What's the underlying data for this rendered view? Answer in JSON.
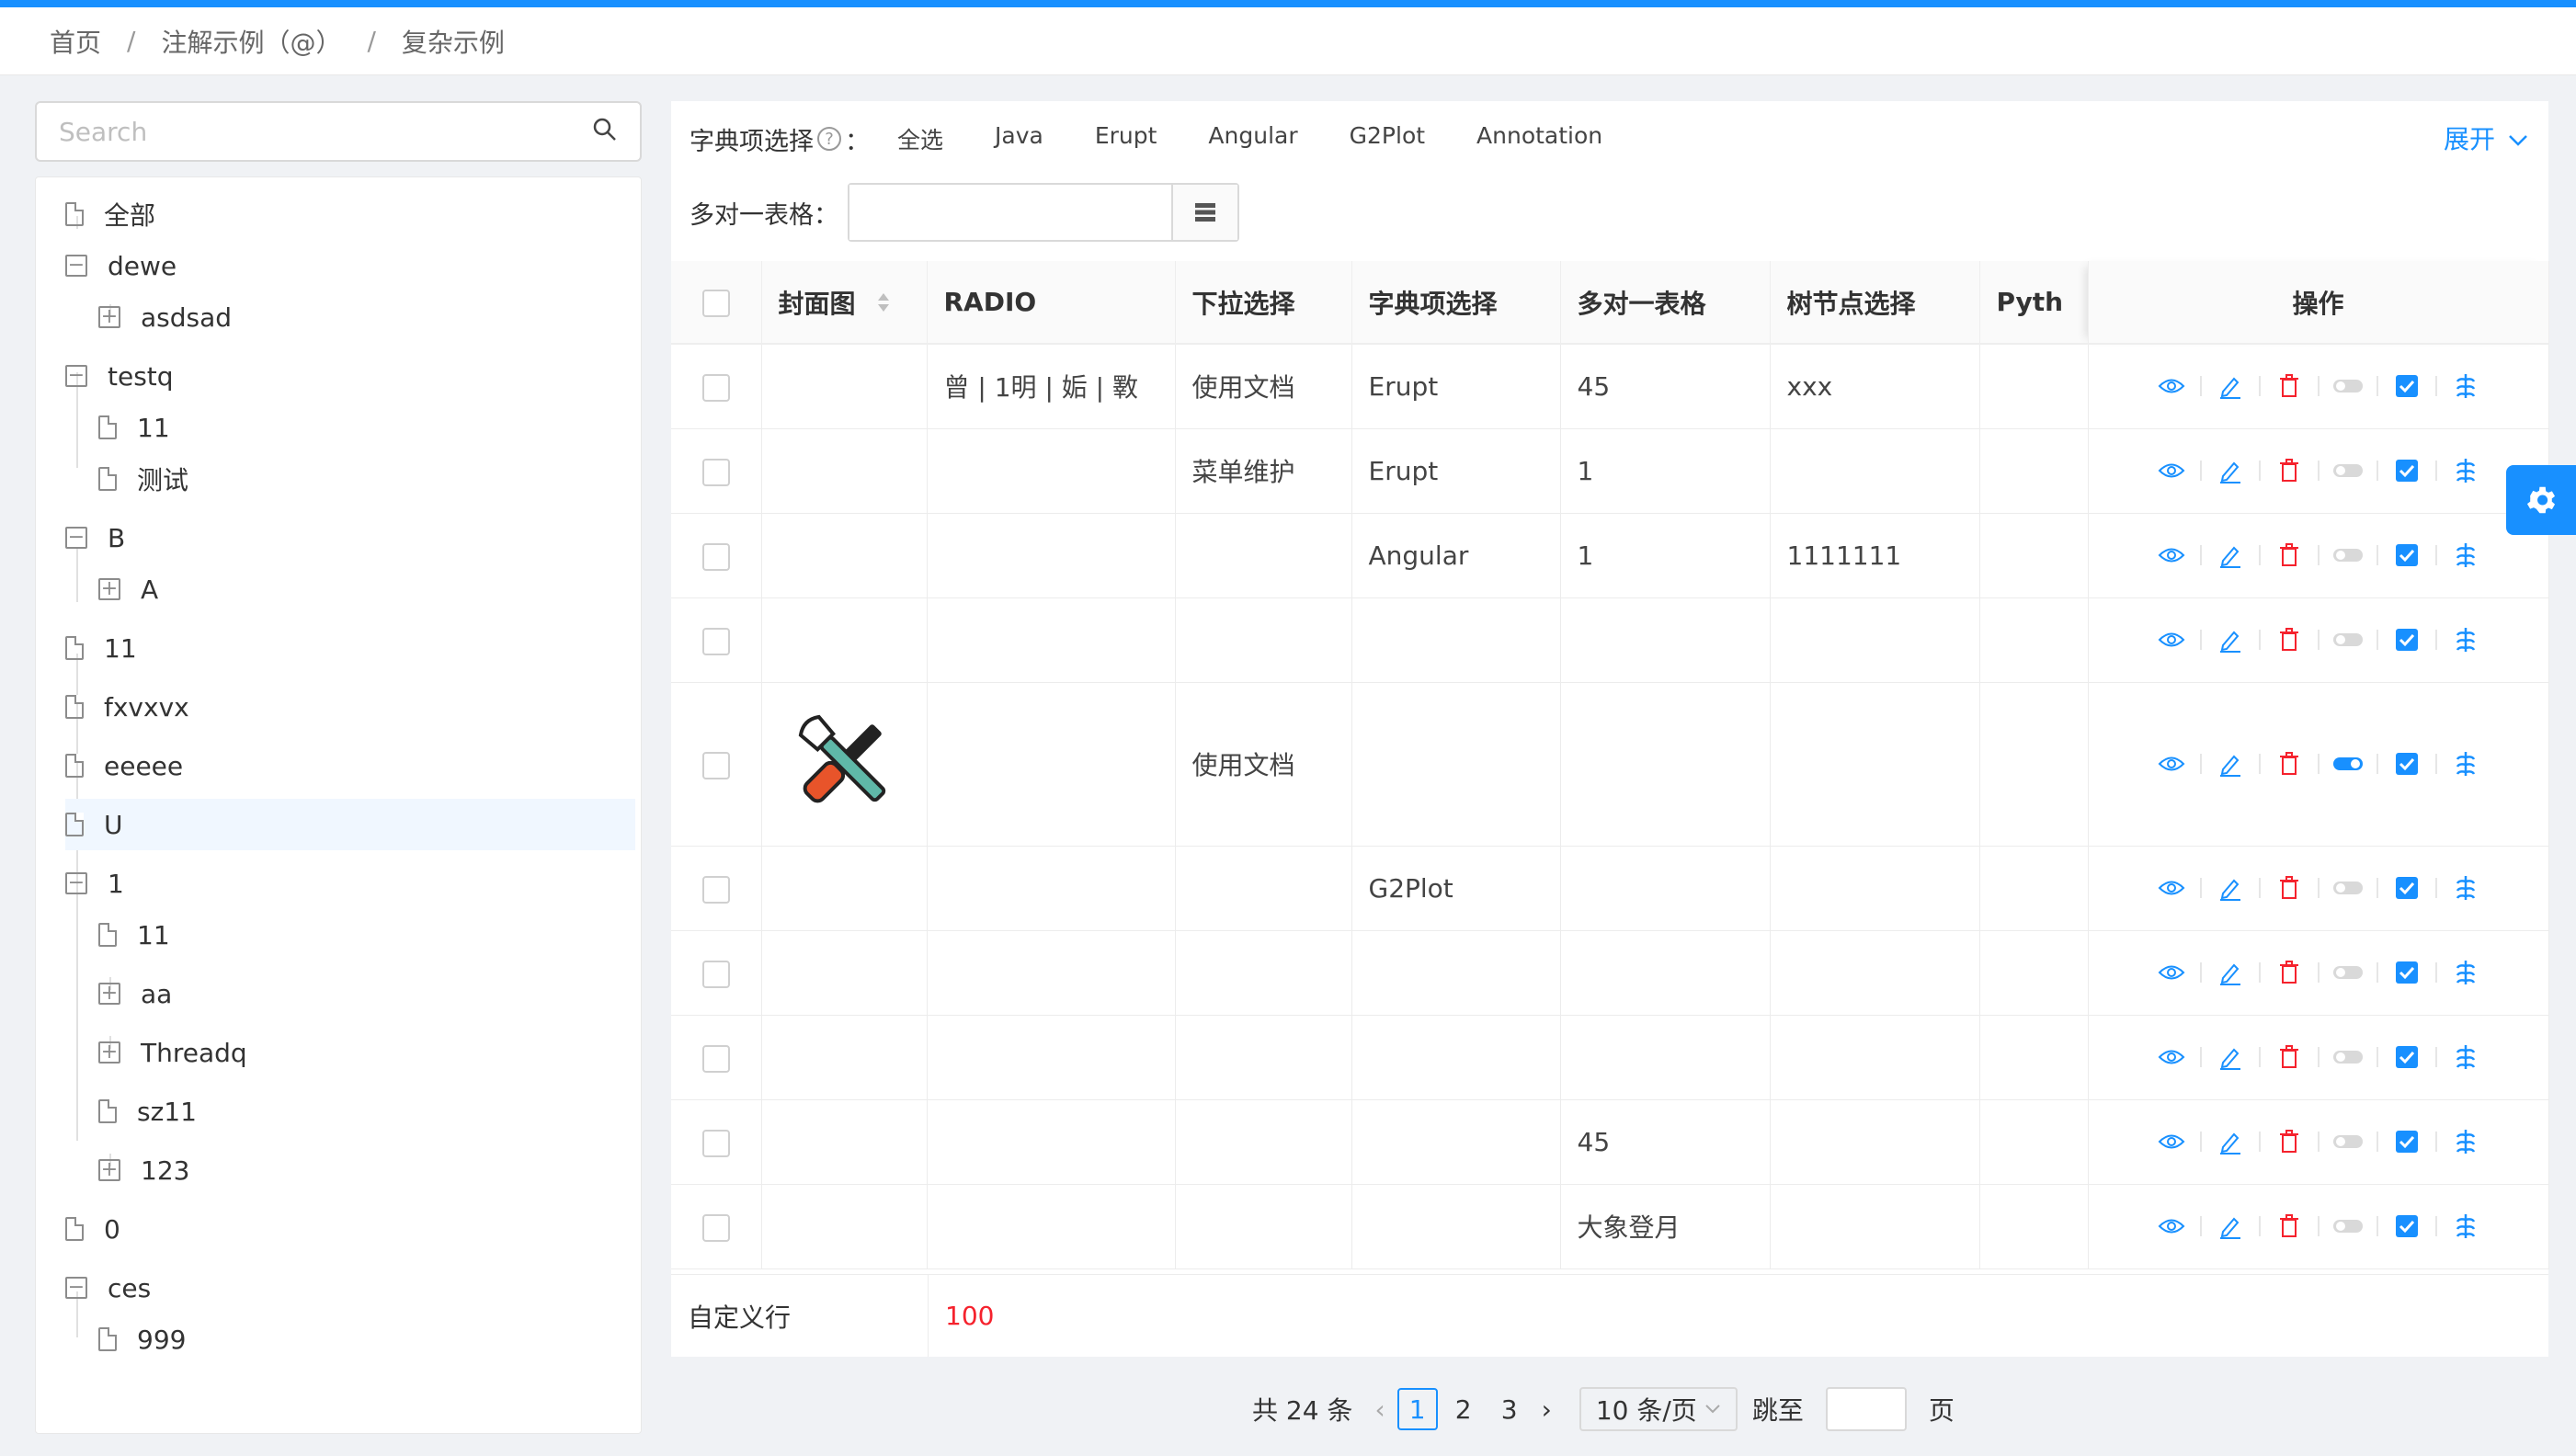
{
  "breadcrumb": [
    "首页",
    "注解示例（@）",
    "复杂示例"
  ],
  "search": {
    "placeholder": "Search"
  },
  "tree": [
    {
      "label": "全部",
      "type": "file"
    },
    {
      "label": "dewe",
      "type": "minus"
    },
    {
      "label": "asdsad",
      "type": "plus"
    },
    {
      "label": "testq",
      "type": "minus"
    },
    {
      "label": "11",
      "type": "file"
    },
    {
      "label": "测试",
      "type": "file"
    },
    {
      "label": "B",
      "type": "minus"
    },
    {
      "label": "A",
      "type": "plus"
    },
    {
      "label": "11",
      "type": "file"
    },
    {
      "label": "fxvxvx",
      "type": "file"
    },
    {
      "label": "eeeee",
      "type": "file"
    },
    {
      "label": "U",
      "type": "file"
    },
    {
      "label": "1",
      "type": "minus"
    },
    {
      "label": "11",
      "type": "file"
    },
    {
      "label": "aa",
      "type": "plus"
    },
    {
      "label": "Threadq",
      "type": "plus"
    },
    {
      "label": "sz11",
      "type": "file"
    },
    {
      "label": "123",
      "type": "plus"
    },
    {
      "label": "0",
      "type": "file"
    },
    {
      "label": "ces",
      "type": "minus"
    },
    {
      "label": "999",
      "type": "file"
    }
  ],
  "filters": {
    "dict_label": "字典项选择",
    "dict_options": [
      "全选",
      "Java",
      "Erupt",
      "Angular",
      "G2Plot",
      "Annotation"
    ],
    "expand_label": "展开",
    "m2o_label": "多对一表格："
  },
  "table": {
    "headers": [
      "封面图",
      "RADIO",
      "下拉选择",
      "字典项选择",
      "多对一表格",
      "树节点选择",
      "Pyth",
      "操作"
    ],
    "rows": [
      [
        "",
        "曾 | 1明 | 姤 | 斁",
        "使用文档",
        "Erupt",
        "45",
        "xxx",
        ""
      ],
      [
        "",
        "",
        "菜单维护",
        "Erupt",
        "1",
        "",
        ""
      ],
      [
        "",
        "",
        "",
        "Angular",
        "1",
        "1111111",
        ""
      ],
      [
        "",
        "",
        "",
        "",
        "",
        "",
        ""
      ],
      [
        "img",
        "",
        "使用文档",
        "",
        "",
        "",
        ""
      ],
      [
        "",
        "",
        "",
        "G2Plot",
        "",
        "",
        ""
      ],
      [
        "",
        "",
        "",
        "",
        "",
        "",
        ""
      ],
      [
        "",
        "",
        "",
        "",
        "",
        "",
        ""
      ],
      [
        "",
        "",
        "",
        "",
        "45",
        "",
        ""
      ],
      [
        "",
        "",
        "",
        "",
        "大象登月",
        "",
        ""
      ]
    ],
    "toggle_on_row": 4
  },
  "custom_row": {
    "label": "自定义行",
    "value": "100"
  },
  "pagination": {
    "total": "共 24 条",
    "pages": [
      "1",
      "2",
      "3"
    ],
    "current": "1",
    "page_size": "10 条/页",
    "jump_label": "跳至",
    "page_suffix": "页"
  },
  "colors": {
    "primary": "#1890ff",
    "danger": "#f5222d"
  }
}
